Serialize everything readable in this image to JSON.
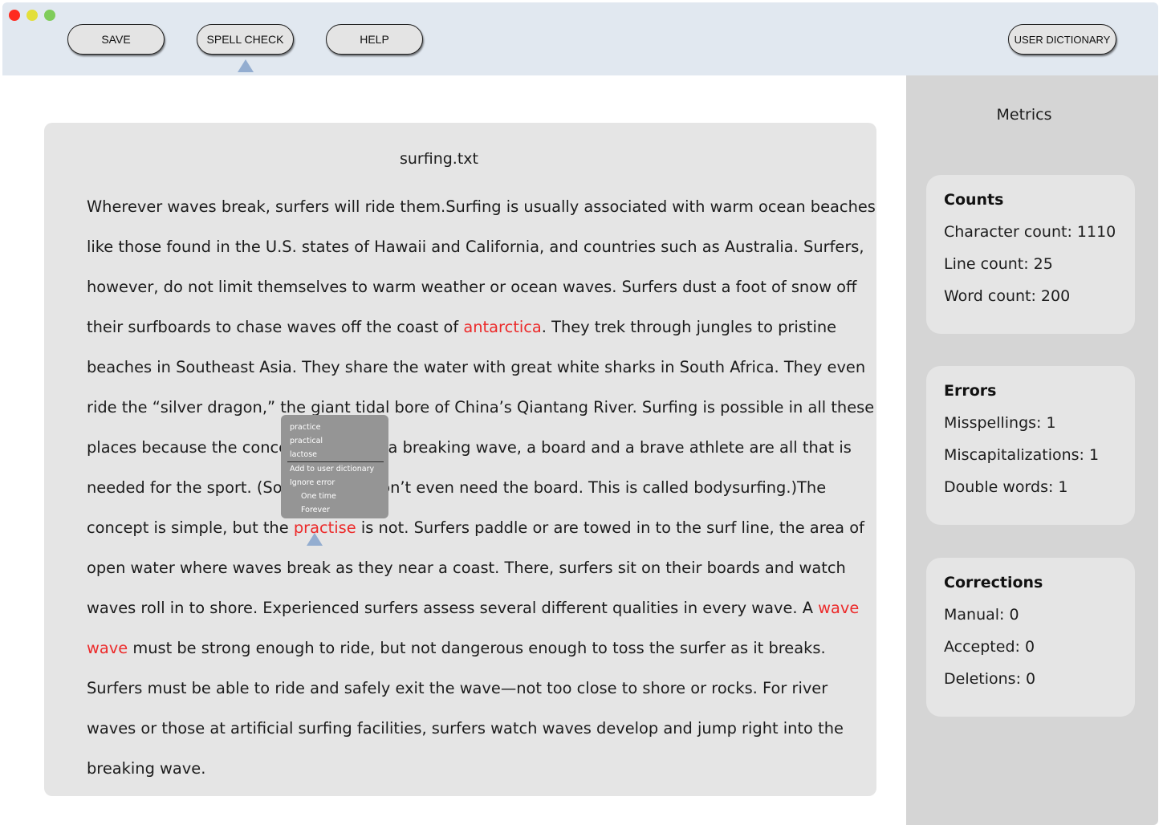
{
  "toolbar": {
    "save_label": "SAVE",
    "spell_check_label": "SPELL CHECK",
    "help_label": "HELP",
    "user_dictionary_label": "USER DICTIONARY"
  },
  "document": {
    "filename": "surfing.txt",
    "lines": [
      [
        {
          "t": "Wherever waves break, surfers will ride them.Surfing is usually associated with warm ocean beaches"
        }
      ],
      [
        {
          "t": "like those found in the U.S. states of Hawaii and California, and countries such as Australia. Surfers,"
        }
      ],
      [
        {
          "t": "however, do not limit themselves to warm weather or ocean waves. Surfers dust a foot of snow off"
        }
      ],
      [
        {
          "t": "their surfboards to chase waves off the coast of "
        },
        {
          "t": "antarctica",
          "err": true
        },
        {
          "t": ". They trek through jungles to pristine"
        }
      ],
      [
        {
          "t": "beaches in Southeast Asia. They share the water with great white sharks in South Africa. They even"
        }
      ],
      [
        {
          "t": "ride the “silver dragon,” the giant tidal bore of China’s Qiantang River. Surfing is possible in all these"
        }
      ],
      [
        {
          "t": "places because the concept is simple: a breaking wave, a board and a brave athlete are all that is"
        }
      ],
      [
        {
          "t": "needed for the sport. (Some surfers don’t even need the board. This is called bodysurfing.)The"
        }
      ],
      [
        {
          "t": "concept is simple, but the "
        },
        {
          "t": "practise",
          "err": true
        },
        {
          "t": " is not. Surfers paddle or are towed in to the surf line, the area of"
        }
      ],
      [
        {
          "t": "open water where waves break as they near a coast. There, surfers sit on their boards and watch"
        }
      ],
      [
        {
          "t": "waves roll in to shore. Experienced surfers assess several different qualities in every wave. A "
        },
        {
          "t": "wave",
          "err": true
        }
      ],
      [
        {
          "t": "wave",
          "err": true
        },
        {
          "t": " must be strong enough to ride, but not dangerous enough to toss the surfer as it breaks."
        }
      ],
      [
        {
          "t": "Surfers must be able to ride and safely exit the wave—not too close to shore or rocks. For river"
        }
      ],
      [
        {
          "t": "waves or those at artificial surfing facilities, surfers watch waves develop and jump right into the"
        }
      ],
      [
        {
          "t": "breaking wave."
        }
      ]
    ]
  },
  "context_menu": {
    "suggestions": [
      "practice",
      "practical",
      "lactose"
    ],
    "add_to_dictionary": "Add to user dictionary",
    "ignore_error": "Ignore error",
    "one_time": "One time",
    "forever": "Forever"
  },
  "metrics": {
    "title": "Metrics",
    "counts": {
      "heading": "Counts",
      "character_count": "Character count: 1110",
      "line_count": "Line count: 25",
      "word_count": "Word count: 200"
    },
    "errors": {
      "heading": "Errors",
      "misspellings": "Misspellings: 1",
      "miscapitalizations": "Miscapitalizations: 1",
      "double_words": "Double words: 1"
    },
    "corrections": {
      "heading": "Corrections",
      "manual": "Manual: 0",
      "accepted": "Accepted: 0",
      "deletions": "Deletions: 0"
    }
  },
  "colors": {
    "error_text": "#ec2a2a",
    "pointer": "#93add0",
    "toolbar_bg": "#e1e8f0"
  }
}
